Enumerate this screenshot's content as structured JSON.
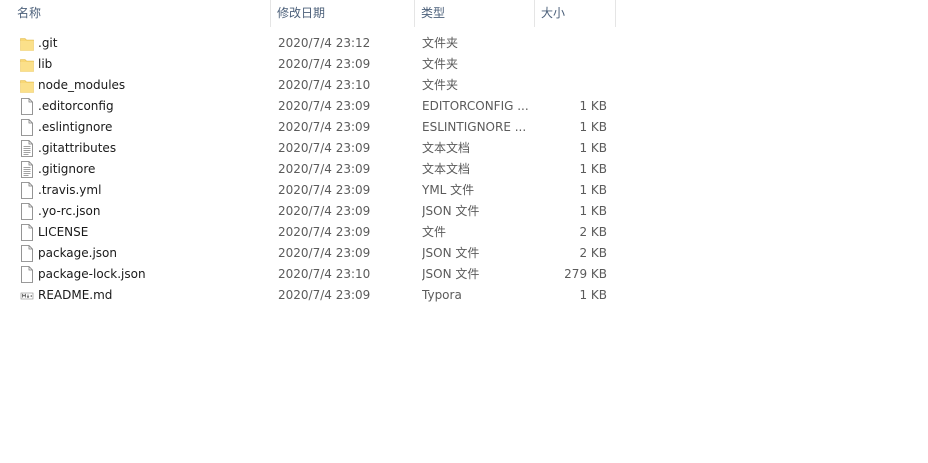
{
  "header": {
    "name": "名称",
    "date": "修改日期",
    "type": "类型",
    "size": "大小"
  },
  "files": [
    {
      "name": ".git",
      "date": "2020/7/4 23:12",
      "type": "文件夹",
      "size": "",
      "icon": "folder-icon"
    },
    {
      "name": "lib",
      "date": "2020/7/4 23:09",
      "type": "文件夹",
      "size": "",
      "icon": "folder-icon"
    },
    {
      "name": "node_modules",
      "date": "2020/7/4 23:10",
      "type": "文件夹",
      "size": "",
      "icon": "folder-icon"
    },
    {
      "name": ".editorconfig",
      "date": "2020/7/4 23:09",
      "type": "EDITORCONFIG ...",
      "size": "1 KB",
      "icon": "file-icon"
    },
    {
      "name": ".eslintignore",
      "date": "2020/7/4 23:09",
      "type": "ESLINTIGNORE ...",
      "size": "1 KB",
      "icon": "file-icon"
    },
    {
      "name": ".gitattributes",
      "date": "2020/7/4 23:09",
      "type": "文本文档",
      "size": "1 KB",
      "icon": "text-file-icon"
    },
    {
      "name": ".gitignore",
      "date": "2020/7/4 23:09",
      "type": "文本文档",
      "size": "1 KB",
      "icon": "text-file-icon"
    },
    {
      "name": ".travis.yml",
      "date": "2020/7/4 23:09",
      "type": "YML 文件",
      "size": "1 KB",
      "icon": "file-icon"
    },
    {
      "name": ".yo-rc.json",
      "date": "2020/7/4 23:09",
      "type": "JSON 文件",
      "size": "1 KB",
      "icon": "file-icon"
    },
    {
      "name": "LICENSE",
      "date": "2020/7/4 23:09",
      "type": "文件",
      "size": "2 KB",
      "icon": "file-icon"
    },
    {
      "name": "package.json",
      "date": "2020/7/4 23:09",
      "type": "JSON 文件",
      "size": "2 KB",
      "icon": "file-icon"
    },
    {
      "name": "package-lock.json",
      "date": "2020/7/4 23:10",
      "type": "JSON 文件",
      "size": "279 KB",
      "icon": "file-icon"
    },
    {
      "name": "README.md",
      "date": "2020/7/4 23:09",
      "type": "Typora",
      "size": "1 KB",
      "icon": "markdown-file-icon"
    }
  ],
  "colors": {
    "folder": "#f8d775",
    "header_text": "#4c607a",
    "detail_text": "#5b5b5b"
  }
}
